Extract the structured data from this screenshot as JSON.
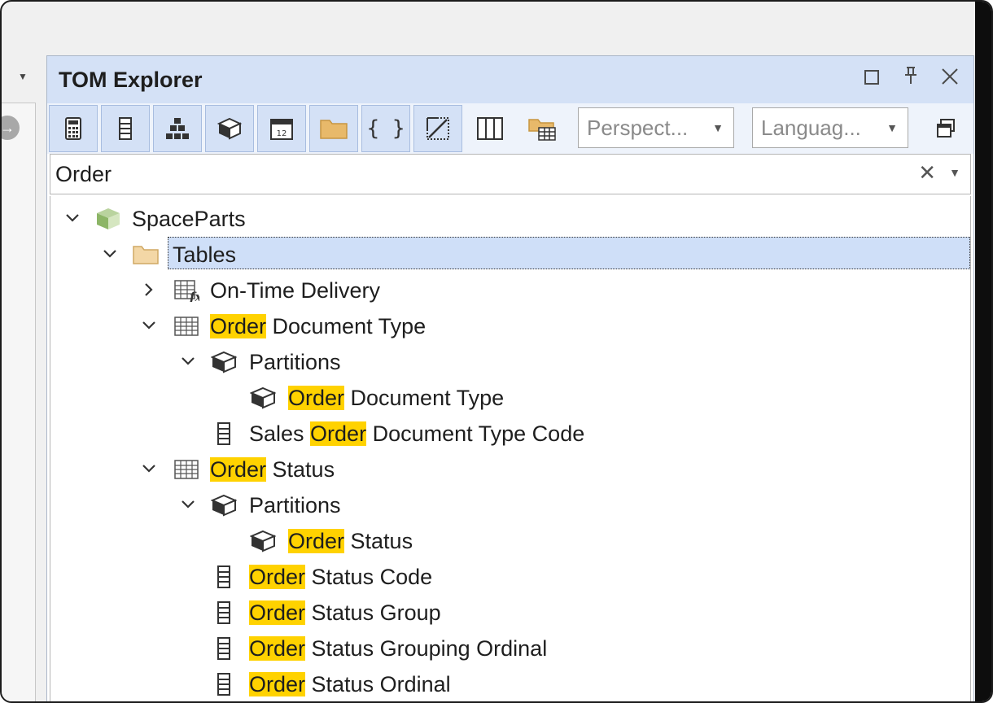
{
  "window": {
    "title": "TOM Explorer",
    "buttons": [
      "maximize",
      "pin",
      "close"
    ]
  },
  "toolbar": {
    "toggle_buttons": [
      {
        "name": "show-measures",
        "icon": "calculator-icon",
        "active": true
      },
      {
        "name": "show-columns",
        "icon": "column-icon",
        "active": true
      },
      {
        "name": "show-hierarchies",
        "icon": "hierarchy-icon",
        "active": true
      },
      {
        "name": "show-partitions",
        "icon": "partition-icon",
        "active": true
      },
      {
        "name": "show-calendar",
        "icon": "calendar-icon",
        "active": true
      },
      {
        "name": "show-folders",
        "icon": "folder-icon",
        "active": true
      },
      {
        "name": "show-expressions",
        "icon": "braces-icon",
        "active": true
      },
      {
        "name": "show-hidden",
        "icon": "hidden-objects-icon",
        "active": true
      },
      {
        "name": "show-all-columns",
        "icon": "columns-grid-icon",
        "active": false
      },
      {
        "name": "display-folders",
        "icon": "folder-table-icon",
        "active": false
      }
    ],
    "perspective": {
      "placeholder": "Perspect..."
    },
    "language": {
      "placeholder": "Languag..."
    },
    "extra_button_icon": "window-icon"
  },
  "search": {
    "value": "Order"
  },
  "tree": {
    "rows": [
      {
        "pre": "",
        "match": "",
        "post": "SpaceParts"
      },
      {
        "pre": "",
        "match": "",
        "post": "Tables"
      },
      {
        "pre": "",
        "match": "",
        "post": "On-Time Delivery"
      },
      {
        "pre": "",
        "match": "Order",
        "post": " Document Type"
      },
      {
        "pre": "",
        "match": "",
        "post": "Partitions"
      },
      {
        "pre": "",
        "match": "Order",
        "post": " Document Type"
      },
      {
        "pre": "Sales ",
        "match": "Order",
        "post": " Document Type Code"
      },
      {
        "pre": "",
        "match": "Order",
        "post": " Status"
      },
      {
        "pre": "",
        "match": "",
        "post": "Partitions"
      },
      {
        "pre": "",
        "match": "Order",
        "post": " Status"
      },
      {
        "pre": "",
        "match": "Order",
        "post": " Status Code"
      },
      {
        "pre": "",
        "match": "Order",
        "post": " Status Group"
      },
      {
        "pre": "",
        "match": "Order",
        "post": " Status Grouping Ordinal"
      },
      {
        "pre": "",
        "match": "Order",
        "post": " Status Ordinal"
      }
    ]
  },
  "colors": {
    "titlebar": "#d4e1f6",
    "highlight": "#ffd200",
    "selection": "#cfdff8"
  }
}
